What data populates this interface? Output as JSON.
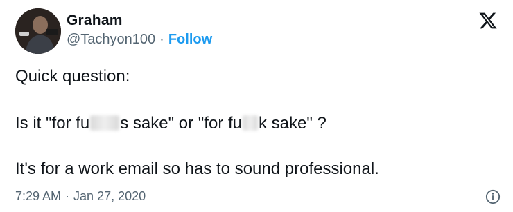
{
  "author": {
    "name": "Graham",
    "handle": "@Tachyon100",
    "separator": "·",
    "follow_label": "Follow"
  },
  "icons": {
    "close": "x-logo-icon",
    "info": "info-icon"
  },
  "tweet": {
    "line1": "Quick question:",
    "line2_part1": "Is it \"for fu",
    "line2_part2": "s sake\" or \"for fu",
    "line2_part3": "k sake\" ?",
    "line3": "It's for a work email so has to sound professional."
  },
  "meta": {
    "time": "7:29 AM",
    "separator": "·",
    "date": "Jan 27, 2020"
  },
  "colors": {
    "text": "#0f1419",
    "secondary": "#536471",
    "accent": "#1d9bf0"
  }
}
